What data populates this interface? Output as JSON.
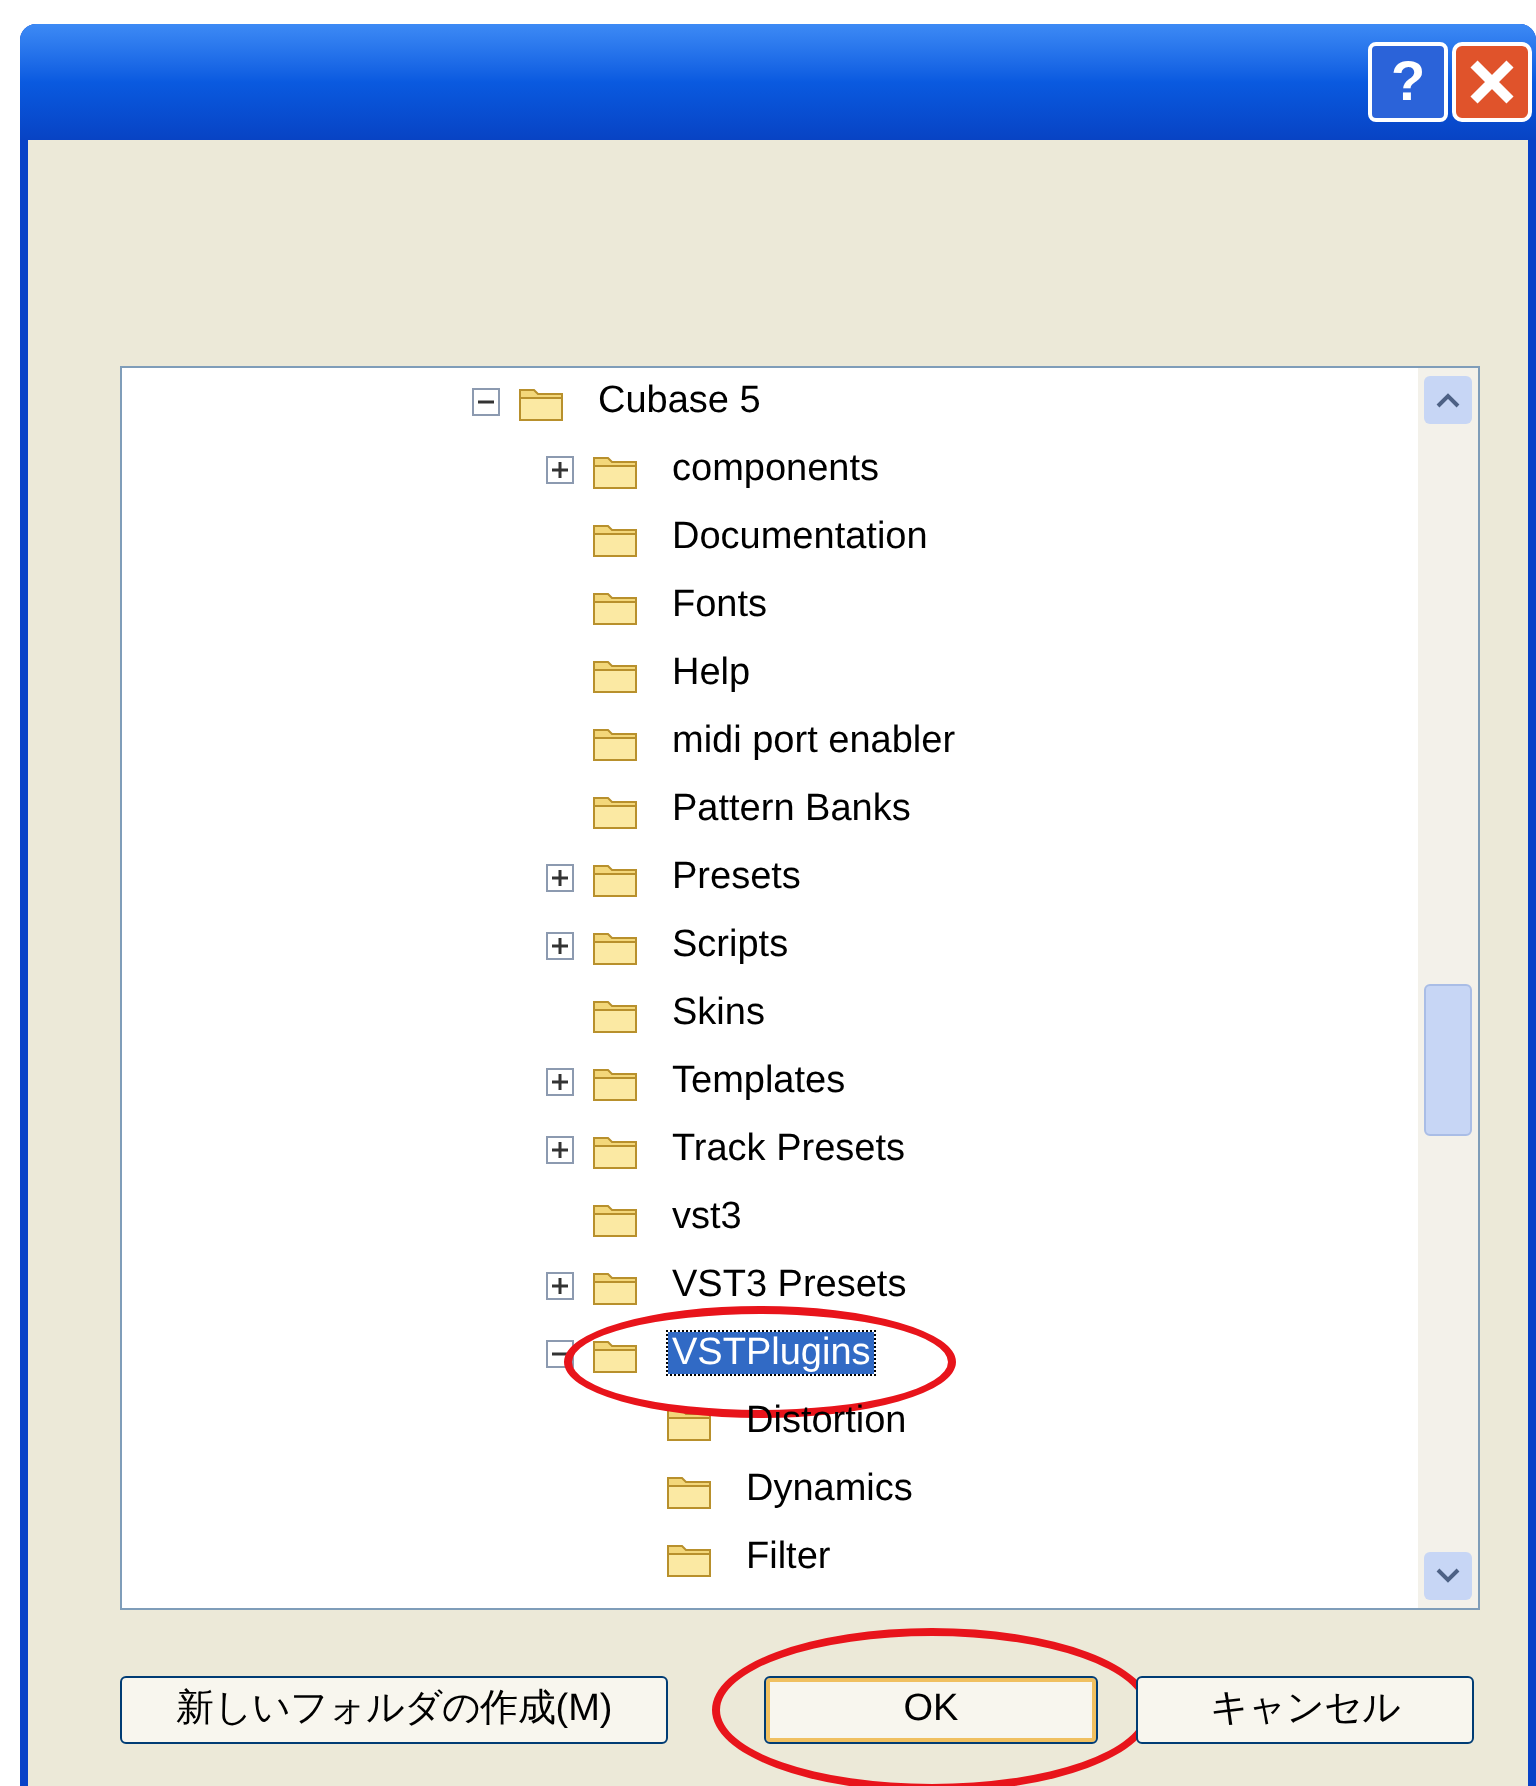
{
  "window": {
    "help_button": "?"
  },
  "tree": {
    "label": "Cubase 5",
    "kind": "expanded",
    "selected": false,
    "circled": false,
    "children": [
      {
        "label": "components",
        "kind": "collapsed",
        "selected": false,
        "circled": false
      },
      {
        "label": "Documentation",
        "kind": "leaf",
        "selected": false,
        "circled": false
      },
      {
        "label": "Fonts",
        "kind": "leaf",
        "selected": false,
        "circled": false
      },
      {
        "label": "Help",
        "kind": "leaf",
        "selected": false,
        "circled": false
      },
      {
        "label": "midi port enabler",
        "kind": "leaf",
        "selected": false,
        "circled": false
      },
      {
        "label": "Pattern Banks",
        "kind": "leaf",
        "selected": false,
        "circled": false
      },
      {
        "label": "Presets",
        "kind": "collapsed",
        "selected": false,
        "circled": false
      },
      {
        "label": "Scripts",
        "kind": "collapsed",
        "selected": false,
        "circled": false
      },
      {
        "label": "Skins",
        "kind": "leaf",
        "selected": false,
        "circled": false
      },
      {
        "label": "Templates",
        "kind": "collapsed",
        "selected": false,
        "circled": false
      },
      {
        "label": "Track Presets",
        "kind": "collapsed",
        "selected": false,
        "circled": false
      },
      {
        "label": "vst3",
        "kind": "leaf",
        "selected": false,
        "circled": false
      },
      {
        "label": "VST3 Presets",
        "kind": "collapsed",
        "selected": false,
        "circled": false
      },
      {
        "label": "VSTPlugins",
        "kind": "expanded",
        "selected": true,
        "circled": true,
        "children": [
          {
            "label": "Distortion",
            "kind": "leaf",
            "selected": false,
            "circled": false
          },
          {
            "label": "Dynamics",
            "kind": "leaf",
            "selected": false,
            "circled": false
          },
          {
            "label": "Filter",
            "kind": "leaf",
            "selected": false,
            "circled": false
          }
        ]
      }
    ]
  },
  "buttons": [
    {
      "label": "新しいフォルダの作成(M)",
      "default": false,
      "circled": false
    },
    {
      "label": "OK",
      "default": true,
      "circled": true
    },
    {
      "label": "キャンセル",
      "default": false,
      "circled": false
    }
  ]
}
